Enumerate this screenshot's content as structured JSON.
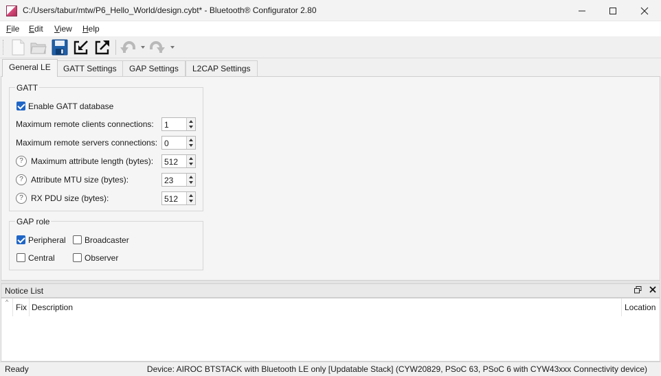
{
  "window": {
    "title": "C:/Users/tabur/mtw/P6_Hello_World/design.cybt* - Bluetooth® Configurator 2.80",
    "icon": "configurator-app-icon"
  },
  "menu": [
    {
      "label": "File",
      "underline": "F",
      "rest": "ile"
    },
    {
      "label": "Edit",
      "underline": "E",
      "rest": "dit"
    },
    {
      "label": "View",
      "underline": "V",
      "rest": "iew"
    },
    {
      "label": "Help",
      "underline": "H",
      "rest": "elp"
    }
  ],
  "toolbar": {
    "icons": [
      "new-file-icon",
      "open-folder-icon",
      "save-icon",
      "import-icon",
      "export-icon",
      "undo-icon",
      "redo-icon"
    ]
  },
  "tabs": [
    {
      "label": "General LE",
      "active": true
    },
    {
      "label": "GATT Settings",
      "active": false
    },
    {
      "label": "GAP Settings",
      "active": false
    },
    {
      "label": "L2CAP Settings",
      "active": false
    }
  ],
  "gatt": {
    "title": "GATT",
    "enable_label": "Enable GATT database",
    "enable_checked": true,
    "fields": [
      {
        "label": "Maximum remote clients connections:",
        "value": "1",
        "help": false
      },
      {
        "label": "Maximum remote servers connections:",
        "value": "0",
        "help": false
      },
      {
        "label": "Maximum attribute length (bytes):",
        "value": "512",
        "help": true
      },
      {
        "label": "Attribute MTU size (bytes):",
        "value": "23",
        "help": true
      },
      {
        "label": "RX PDU size (bytes):",
        "value": "512",
        "help": true
      }
    ],
    "help_glyph": "?"
  },
  "gap_role": {
    "title": "GAP role",
    "options": [
      {
        "label": "Peripheral",
        "checked": true
      },
      {
        "label": "Broadcaster",
        "checked": false
      },
      {
        "label": "Central",
        "checked": false
      },
      {
        "label": "Observer",
        "checked": false
      }
    ]
  },
  "notice_list": {
    "title": "Notice List",
    "columns": {
      "fix": "Fix",
      "description": "Description",
      "location": "Location"
    }
  },
  "status": {
    "left": "Ready",
    "device": "Device: AIROC BTSTACK with Bluetooth LE only [Updatable Stack] (CYW20829, PSoC 63, PSoC 6 with CYW43xxx Connectivity device)"
  },
  "colors": {
    "checkbox_checked": "#1f65c6",
    "save_icon": "#1f5fa8"
  }
}
